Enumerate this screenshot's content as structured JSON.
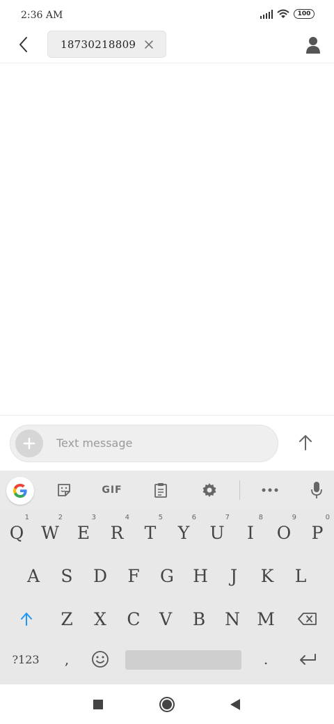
{
  "status_bar": {
    "time": "2:36 AM",
    "battery": "100",
    "icons": [
      "signal-icon",
      "wifi-icon",
      "battery-icon"
    ]
  },
  "header": {
    "back_icon": "chevron-left-icon",
    "recipient_chip": "18730218809",
    "chip_close_icon": "close-icon",
    "contact_icon": "person-icon"
  },
  "compose": {
    "attach_icon": "plus-icon",
    "placeholder": "Text message",
    "send_icon": "arrow-up-icon"
  },
  "keyboard": {
    "toolbar": {
      "items": [
        "google-icon",
        "sticker-icon",
        "GIF",
        "clipboard-icon",
        "gear-icon",
        "more-icon",
        "microphone-icon"
      ],
      "gif_label": "GIF"
    },
    "row1": [
      {
        "key": "Q",
        "sup": "1"
      },
      {
        "key": "W",
        "sup": "2"
      },
      {
        "key": "E",
        "sup": "3"
      },
      {
        "key": "R",
        "sup": "4"
      },
      {
        "key": "T",
        "sup": "5"
      },
      {
        "key": "Y",
        "sup": "6"
      },
      {
        "key": "U",
        "sup": "7"
      },
      {
        "key": "I",
        "sup": "8"
      },
      {
        "key": "O",
        "sup": "9"
      },
      {
        "key": "P",
        "sup": "0"
      }
    ],
    "row2": [
      "A",
      "S",
      "D",
      "F",
      "G",
      "H",
      "J",
      "K",
      "L"
    ],
    "row3": [
      "Z",
      "X",
      "C",
      "V",
      "B",
      "N",
      "M"
    ],
    "row4": {
      "symbols": "?123",
      "comma": ",",
      "period": "."
    },
    "accent_color": "#2196f3"
  },
  "nav_bar": {
    "icons": [
      "square-icon",
      "circle-icon",
      "triangle-back-icon"
    ]
  }
}
